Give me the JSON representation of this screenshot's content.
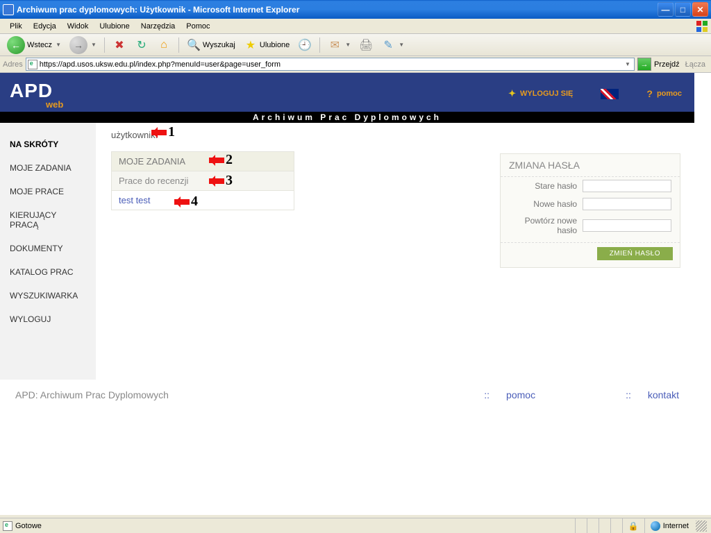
{
  "window": {
    "title": "Archiwum prac dyplomowych: Użytkownik - Microsoft Internet Explorer"
  },
  "menu": {
    "items": [
      "Plik",
      "Edycja",
      "Widok",
      "Ulubione",
      "Narzędzia",
      "Pomoc"
    ]
  },
  "toolbar": {
    "back": "Wstecz",
    "search": "Wyszukaj",
    "favorites": "Ulubione"
  },
  "address": {
    "label": "Adres",
    "url": "https://apd.usos.uksw.edu.pl/index.php?menuId=user&page=user_form",
    "go": "Przejdź",
    "links": "Łącza"
  },
  "header": {
    "logo_main": "APD",
    "logo_sub": "web",
    "logout": "WYLOGUJ SIĘ",
    "help": "pomoc",
    "black_title": "Archiwum Prac Dyplomowych"
  },
  "sidebar": {
    "items": [
      {
        "label": "NA SKRÓTY",
        "head": true
      },
      {
        "label": "MOJE ZADANIA"
      },
      {
        "label": "MOJE PRACE"
      },
      {
        "label": "KIERUJĄCY PRACĄ"
      },
      {
        "label": "DOKUMENTY"
      },
      {
        "label": "KATALOG PRAC"
      },
      {
        "label": "WYSZUKIWARKA"
      },
      {
        "label": "WYLOGUJ"
      }
    ]
  },
  "content": {
    "user_label": "użytkownik:",
    "task_head": "MOJE ZADANIA",
    "task_sub": "Prace do recenzji",
    "task_item": "test test"
  },
  "annotations": {
    "a1": "1",
    "a2": "2",
    "a3": "3",
    "a4": "4"
  },
  "password_panel": {
    "title": "ZMIANA HASŁA",
    "old": "Stare hasło",
    "new": "Nowe hasło",
    "repeat": "Powtórz nowe hasło",
    "button": "ZMIEŃ HASŁO"
  },
  "footer": {
    "left": "APD: Archiwum Prac Dyplomowych",
    "help": "pomoc",
    "contact": "kontakt",
    "sep": "::"
  },
  "status": {
    "done": "Gotowe",
    "zone": "Internet"
  }
}
